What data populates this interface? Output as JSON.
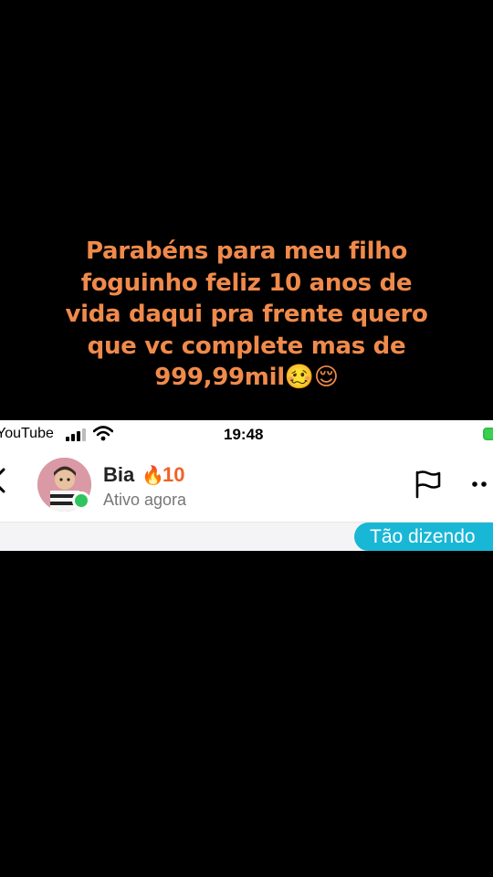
{
  "caption": {
    "lines": [
      "Parabéns para meu filho",
      "foguinho feliz 10 anos de",
      "vida daqui pra frente quero",
      "que vc complete mas de",
      "999,99mil🥴😌"
    ]
  },
  "status_bar": {
    "carrier": "YouTube",
    "time": "19:48"
  },
  "chat_header": {
    "name": "Bia",
    "streak_icon": "🔥",
    "streak_count": "10",
    "presence": "Ativo agora"
  },
  "banner": {
    "text": "Tão dizendo"
  },
  "colors": {
    "caption": "#f08a4b",
    "streak": "#f2602a",
    "pill": "#19b7d6",
    "online": "#2fc45d"
  }
}
